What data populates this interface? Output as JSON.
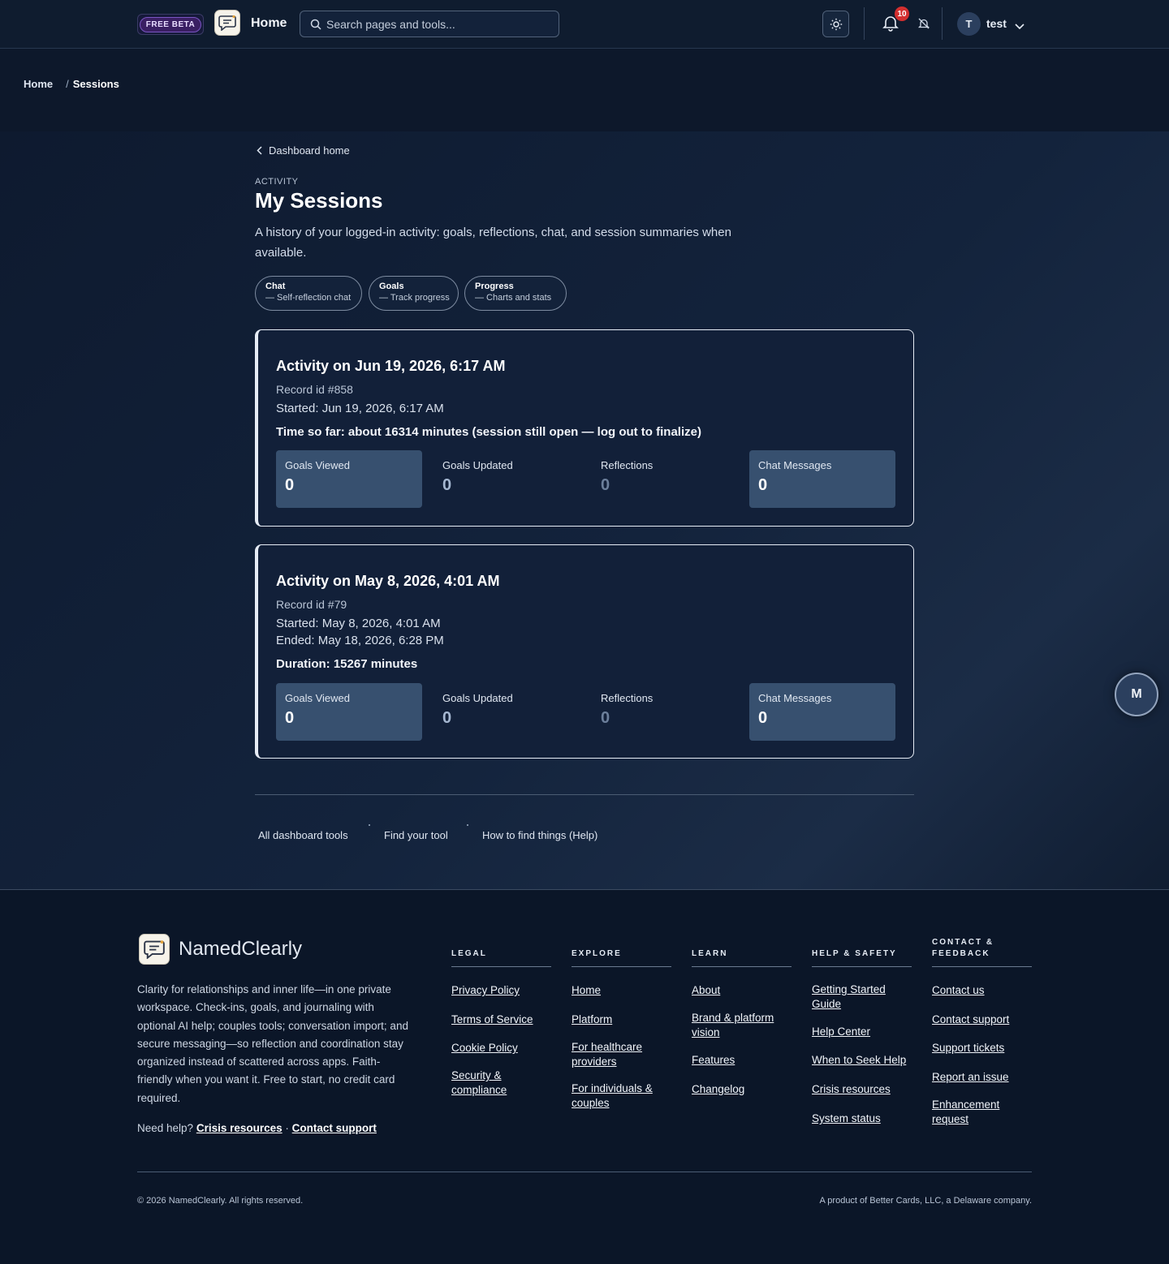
{
  "header": {
    "beta_label": "FREE BETA",
    "home_label": "Home",
    "search_placeholder": "Search pages and tools...",
    "notification_count": "10",
    "avatar_initial": "T",
    "username": "test"
  },
  "breadcrumb": {
    "home": "Home",
    "separator": "/",
    "current": "Sessions"
  },
  "page": {
    "back_link": "Dashboard home",
    "eyebrow": "ACTIVITY",
    "title": "My Sessions",
    "description": "A history of your logged-in activity: goals, reflections, chat, and session summaries when available."
  },
  "pills": [
    {
      "title": "Chat",
      "subtitle": "— Self-reflection chat"
    },
    {
      "title": "Goals",
      "subtitle": "— Track progress"
    },
    {
      "title": "Progress",
      "subtitle": "— Charts and stats"
    }
  ],
  "sessions": [
    {
      "title": "Activity on Jun 19, 2026, 6:17 AM",
      "record_id": "Record id #858",
      "started": "Started: Jun 19, 2026, 6:17 AM",
      "duration": "Time so far: about 16314 minutes (session still open — log out to finalize)",
      "stats": [
        {
          "label": "Goals Viewed",
          "value": "0"
        },
        {
          "label": "Goals Updated",
          "value": "0"
        },
        {
          "label": "Reflections",
          "value": "0"
        },
        {
          "label": "Chat Messages",
          "value": "0"
        }
      ]
    },
    {
      "title": "Activity on May 8, 2026, 4:01 AM",
      "record_id": "Record id #79",
      "started": "Started: May 8, 2026, 4:01 AM",
      "ended": "Ended: May 18, 2026, 6:28 PM",
      "duration": "Duration: 15267 minutes",
      "stats": [
        {
          "label": "Goals Viewed",
          "value": "0"
        },
        {
          "label": "Goals Updated",
          "value": "0"
        },
        {
          "label": "Reflections",
          "value": "0"
        },
        {
          "label": "Chat Messages",
          "value": "0"
        }
      ]
    }
  ],
  "bottom_links": [
    "All dashboard tools",
    "Find your tool",
    "How to find things (Help)"
  ],
  "fab_label": "M",
  "footer": {
    "brand": "NamedClearly",
    "tagline": "Clarity for relationships and inner life—in one private workspace. Check-ins, goals, and journaling with optional AI help; couples tools; conversation import; and secure messaging—so reflection and coordination stay organized instead of scattered across apps. Faith-friendly when you want it. Free to start, no credit card required.",
    "need_help": "Need help?",
    "crisis_link": "Crisis resources",
    "middot": "·",
    "contact_link": "Contact support",
    "columns": [
      {
        "heading": "LEGAL",
        "links": [
          "Privacy Policy",
          "Terms of Service",
          "Cookie Policy",
          "Security & compliance"
        ]
      },
      {
        "heading": "EXPLORE",
        "links": [
          "Home",
          "Platform",
          "For healthcare providers",
          "For individuals & couples"
        ]
      },
      {
        "heading": "LEARN",
        "links": [
          "About",
          "Brand & platform vision",
          "Features",
          "Changelog"
        ]
      },
      {
        "heading": "HELP & SAFETY",
        "links": [
          "Getting Started Guide",
          "Help Center",
          "When to Seek Help",
          "Crisis resources",
          "System status"
        ]
      },
      {
        "heading": "CONTACT & FEEDBACK",
        "links": [
          "Contact us",
          "Contact support",
          "Support tickets",
          "Report an issue",
          "Enhancement request"
        ]
      }
    ],
    "copyright": "© 2026 NamedClearly. All rights reserved.",
    "product_of": "A product of Better Cards, LLC, a Delaware company."
  },
  "colors": {
    "background": "#0b1628",
    "card_highlight": "#37506f",
    "badge": "#d32f2f",
    "beta_accent": "#7a56c2"
  }
}
